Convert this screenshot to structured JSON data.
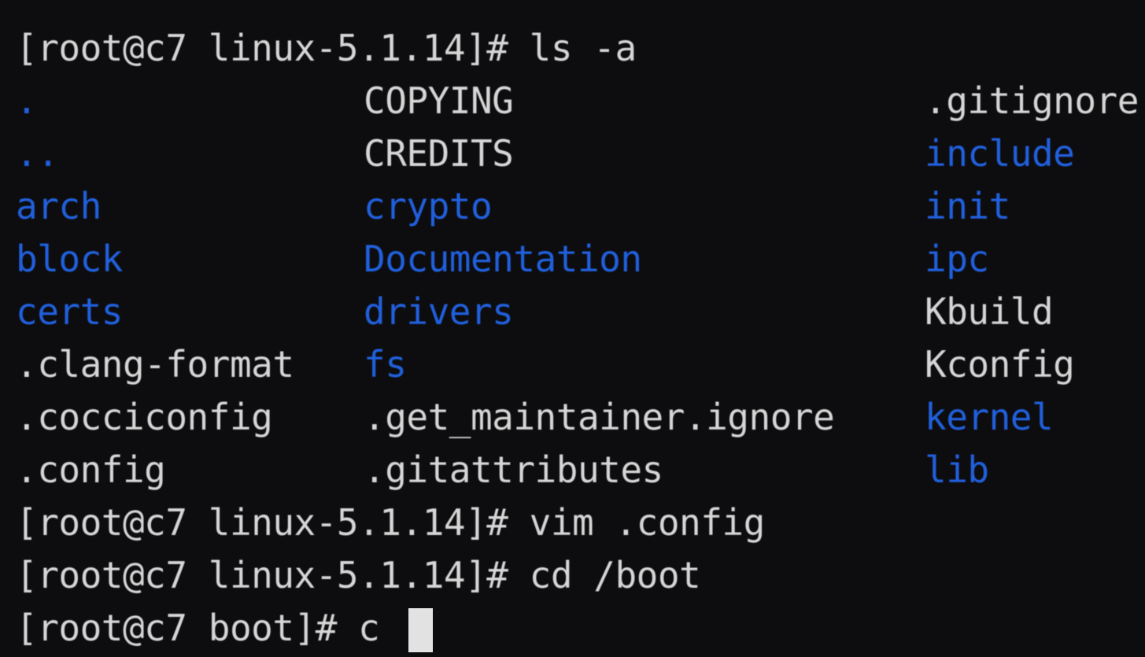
{
  "terminal": {
    "background_color": "#0d0d0f",
    "text_color": "#d6d6d6",
    "directory_color": "#2160dd",
    "cursor_color": "#e2e2e2",
    "prompt_host": "c7",
    "prompt_user": "root"
  },
  "lines": [
    {
      "type": "command",
      "text": "[root@c7 linux-5.1.14]# ls -a"
    },
    {
      "type": "listing",
      "col1": {
        "name": ".",
        "kind": "dir"
      },
      "col2": {
        "name": "COPYING",
        "kind": "file"
      },
      "col3": {
        "name": ".gitignore",
        "kind": "file",
        "clipped": true
      }
    },
    {
      "type": "listing",
      "col1": {
        "name": "..",
        "kind": "dir"
      },
      "col2": {
        "name": "CREDITS",
        "kind": "file"
      },
      "col3": {
        "name": "include",
        "kind": "dir"
      }
    },
    {
      "type": "listing",
      "col1": {
        "name": "arch",
        "kind": "dir"
      },
      "col2": {
        "name": "crypto",
        "kind": "dir"
      },
      "col3": {
        "name": "init",
        "kind": "dir"
      }
    },
    {
      "type": "listing",
      "col1": {
        "name": "block",
        "kind": "dir"
      },
      "col2": {
        "name": "Documentation",
        "kind": "dir"
      },
      "col3": {
        "name": "ipc",
        "kind": "dir"
      }
    },
    {
      "type": "listing",
      "col1": {
        "name": "certs",
        "kind": "dir"
      },
      "col2": {
        "name": "drivers",
        "kind": "dir"
      },
      "col3": {
        "name": "Kbuild",
        "kind": "file"
      }
    },
    {
      "type": "listing",
      "col1": {
        "name": ".clang-format",
        "kind": "file"
      },
      "col2": {
        "name": "fs",
        "kind": "dir"
      },
      "col3": {
        "name": "Kconfig",
        "kind": "file"
      }
    },
    {
      "type": "listing",
      "col1": {
        "name": ".cocciconfig",
        "kind": "file"
      },
      "col2": {
        "name": ".get_maintainer.ignore",
        "kind": "file"
      },
      "col3": {
        "name": "kernel",
        "kind": "dir"
      }
    },
    {
      "type": "listing",
      "col1": {
        "name": ".config",
        "kind": "file"
      },
      "col2": {
        "name": ".gitattributes",
        "kind": "file"
      },
      "col3": {
        "name": "lib",
        "kind": "dir"
      }
    },
    {
      "type": "command",
      "text": "[root@c7 linux-5.1.14]# vim .config"
    },
    {
      "type": "command",
      "text": "[root@c7 linux-5.1.14]# cd /boot"
    },
    {
      "type": "command_active",
      "text": "[root@c7 boot]# c"
    }
  ]
}
